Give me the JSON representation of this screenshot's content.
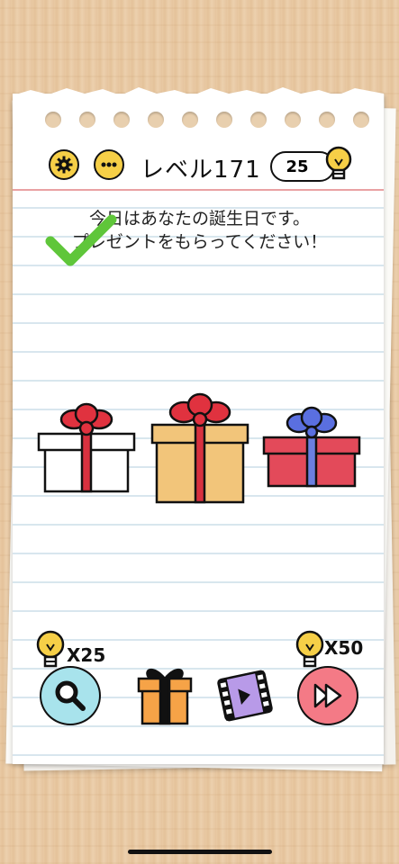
{
  "header": {
    "level_label": "レベル171",
    "hint_count": "25"
  },
  "question": {
    "line1": "今日はあなたの誕生日です。",
    "line2": "プレゼントをもらってください！"
  },
  "gifts": [
    {
      "name": "white-gift",
      "box": "#ffffff",
      "ribbon": "#d8313f",
      "bow": "#e0323f"
    },
    {
      "name": "orange-gift",
      "box": "#f2c57a",
      "ribbon": "#d8313f",
      "bow": "#e0323f"
    },
    {
      "name": "red-gift",
      "box": "#e34a5a",
      "ribbon": "#6b7fe0",
      "bow": "#5a6fe0"
    }
  ],
  "bottom": {
    "hint_cost": "X25",
    "skip_cost": "X50"
  },
  "colors": {
    "accent_yellow": "#f6cf47",
    "check_green": "#5fc63a",
    "search_blue": "#a8e3ec",
    "skip_pink": "#f47a86",
    "video_purple": "#b89ae8"
  }
}
